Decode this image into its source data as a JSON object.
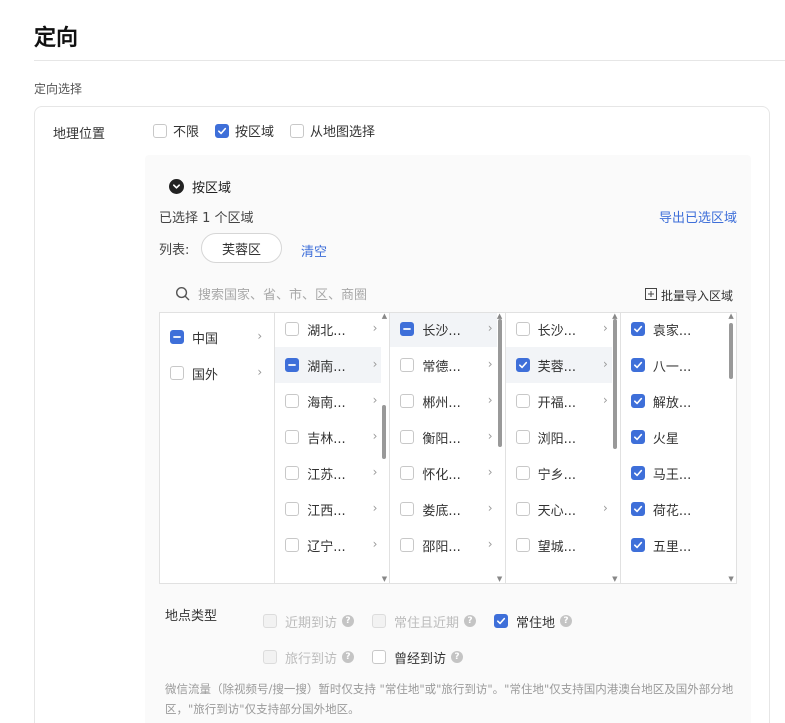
{
  "page": {
    "title": "定向",
    "section_label": "定向选择"
  },
  "geo": {
    "label": "地理位置",
    "options": [
      {
        "label": "不限",
        "checked": false
      },
      {
        "label": "按区域",
        "checked": true
      },
      {
        "label": "从地图选择",
        "checked": false
      }
    ]
  },
  "region_panel": {
    "header": "按区域",
    "selected_text": "已选择 1 个区域",
    "export_link": "导出已选区域",
    "list_label": "列表:",
    "selected_tag": "芙蓉区",
    "clear_link": "清空",
    "search_placeholder": "搜索国家、省、市、区、商圈",
    "bulk_import": "批量导入区域"
  },
  "cascader": {
    "columns": [
      {
        "rows": [
          {
            "label": "中国",
            "state": "partial",
            "has_children": true,
            "active": false
          },
          {
            "label": "国外",
            "state": "unchecked",
            "has_children": true,
            "active": false
          }
        ],
        "scrollbar": false
      },
      {
        "rows": [
          {
            "label": "湖北...",
            "state": "unchecked",
            "has_children": true,
            "active": false
          },
          {
            "label": "湖南...",
            "state": "partial",
            "has_children": true,
            "active": true
          },
          {
            "label": "海南...",
            "state": "unchecked",
            "has_children": true,
            "active": false
          },
          {
            "label": "吉林...",
            "state": "unchecked",
            "has_children": true,
            "active": false
          },
          {
            "label": "江苏...",
            "state": "unchecked",
            "has_children": true,
            "active": false
          },
          {
            "label": "江西...",
            "state": "unchecked",
            "has_children": true,
            "active": false
          },
          {
            "label": "辽宁...",
            "state": "unchecked",
            "has_children": true,
            "active": false
          }
        ],
        "scrollbar": true
      },
      {
        "rows": [
          {
            "label": "长沙...",
            "state": "partial",
            "has_children": true,
            "active": true
          },
          {
            "label": "常德...",
            "state": "unchecked",
            "has_children": true,
            "active": false
          },
          {
            "label": "郴州...",
            "state": "unchecked",
            "has_children": true,
            "active": false
          },
          {
            "label": "衡阳...",
            "state": "unchecked",
            "has_children": true,
            "active": false
          },
          {
            "label": "怀化...",
            "state": "unchecked",
            "has_children": true,
            "active": false
          },
          {
            "label": "娄底...",
            "state": "unchecked",
            "has_children": true,
            "active": false
          },
          {
            "label": "邵阳...",
            "state": "unchecked",
            "has_children": true,
            "active": false
          }
        ],
        "scrollbar": true
      },
      {
        "rows": [
          {
            "label": "长沙...",
            "state": "unchecked",
            "has_children": true,
            "active": false
          },
          {
            "label": "芙蓉...",
            "state": "checked",
            "has_children": true,
            "active": true
          },
          {
            "label": "开福...",
            "state": "unchecked",
            "has_children": true,
            "active": false
          },
          {
            "label": "浏阳...",
            "state": "unchecked",
            "has_children": false,
            "active": false
          },
          {
            "label": "宁乡...",
            "state": "unchecked",
            "has_children": false,
            "active": false
          },
          {
            "label": "天心...",
            "state": "unchecked",
            "has_children": true,
            "active": false
          },
          {
            "label": "望城...",
            "state": "unchecked",
            "has_children": false,
            "active": false
          }
        ],
        "scrollbar": true
      },
      {
        "rows": [
          {
            "label": "袁家...",
            "state": "checked",
            "has_children": false,
            "active": false
          },
          {
            "label": "八一...",
            "state": "checked",
            "has_children": false,
            "active": false
          },
          {
            "label": "解放...",
            "state": "checked",
            "has_children": false,
            "active": false
          },
          {
            "label": "火星",
            "state": "checked",
            "has_children": false,
            "active": false
          },
          {
            "label": "马王...",
            "state": "checked",
            "has_children": false,
            "active": false
          },
          {
            "label": "荷花...",
            "state": "checked",
            "has_children": false,
            "active": false
          },
          {
            "label": "五里...",
            "state": "checked",
            "has_children": false,
            "active": false
          }
        ],
        "scrollbar": true
      }
    ]
  },
  "location_type": {
    "label": "地点类型",
    "rows": [
      [
        {
          "label": "近期到访",
          "checked": false,
          "disabled": true,
          "help": true
        },
        {
          "label": "常住且近期",
          "checked": false,
          "disabled": true,
          "help": true
        },
        {
          "label": "常住地",
          "checked": true,
          "disabled": false,
          "help": true
        }
      ],
      [
        {
          "label": "旅行到访",
          "checked": false,
          "disabled": true,
          "help": true
        },
        {
          "label": "曾经到访",
          "checked": false,
          "disabled": false,
          "help": true
        }
      ]
    ]
  },
  "note": "微信流量（除视频号/搜一搜）暂时仅支持 \"常住地\"或\"旅行到访\"。\"常住地\"仅支持国内港澳台地区及国外部分地区，\"旅行到访\"仅支持部分国外地区。",
  "colors": {
    "accent": "#3e6fd9",
    "border": "#e1e1e1",
    "panel_bg": "#fafafa"
  }
}
